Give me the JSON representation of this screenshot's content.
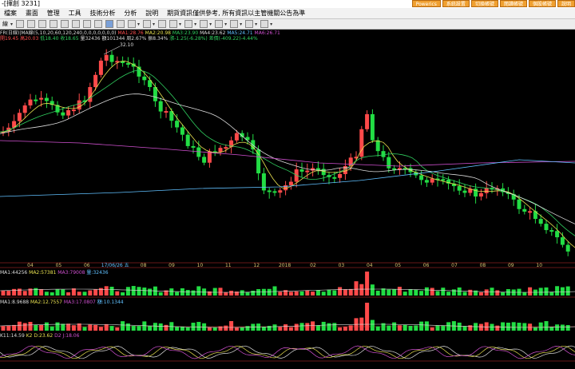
{
  "window": {
    "title": "-[揮創 3231]"
  },
  "top_buttons": [
    "Powerics",
    "系統設置",
    "切換帳號",
    "閱讀帳號",
    "個股帳號",
    "說明"
  ],
  "menu": [
    "檔案",
    "畫面",
    "管理",
    "工具",
    "技術分析",
    "分析",
    "說明",
    "期貨資訊僅供參考, 所有資訊以主管機關公告為準"
  ],
  "toolbar": {
    "label": "線"
  },
  "info_line1": {
    "prefix": "FR(日線)|MA線(5,10,20,60,120,240,0,0,0,0,0,0,0)",
    "ma1": "MA1:28.76",
    "ma2": "MA2:20.98",
    "ma3": "MA3:23.90",
    "ma4": "MA4:23.62",
    "ma5": "MA5:24.71",
    "ma6": "MA6:26.71"
  },
  "info_line2": {
    "open": "開19.45",
    "high": "高20.03",
    "low": "低18.40",
    "close": "收18.65",
    "volume": "量32436",
    "amount": "額101344",
    "turnover": "周2.67%",
    "amp": "振8.34%",
    "change": "漲-1.25(-6.28%)",
    "diff": "差價(-409.22)-4.44%"
  },
  "peak_label": "32.10",
  "date_axis": [
    "04",
    "05",
    "06",
    "17/06/26 五",
    "08",
    "09",
    "10",
    "11",
    "12",
    "2018",
    "02",
    "03",
    "04",
    "05",
    "06",
    "07",
    "08",
    "09",
    "10"
  ],
  "volume_panel": {
    "labels": [
      "MA1:44256",
      "MA2:57381",
      "MA3:79008",
      "量:32436"
    ]
  },
  "amount_panel": {
    "labels": [
      "MA1:8.9688",
      "MA2:12.7557",
      "MA3:17.0807",
      "額:10.1344"
    ]
  },
  "osc_panel": {
    "labels": [
      "K11:14.59",
      "K2 D:23.62",
      "D2 J:18.06"
    ]
  },
  "colors": {
    "up": "#ff4a4a",
    "down": "#22dd44",
    "bg": "#000000",
    "axis": "#cc3030"
  }
}
